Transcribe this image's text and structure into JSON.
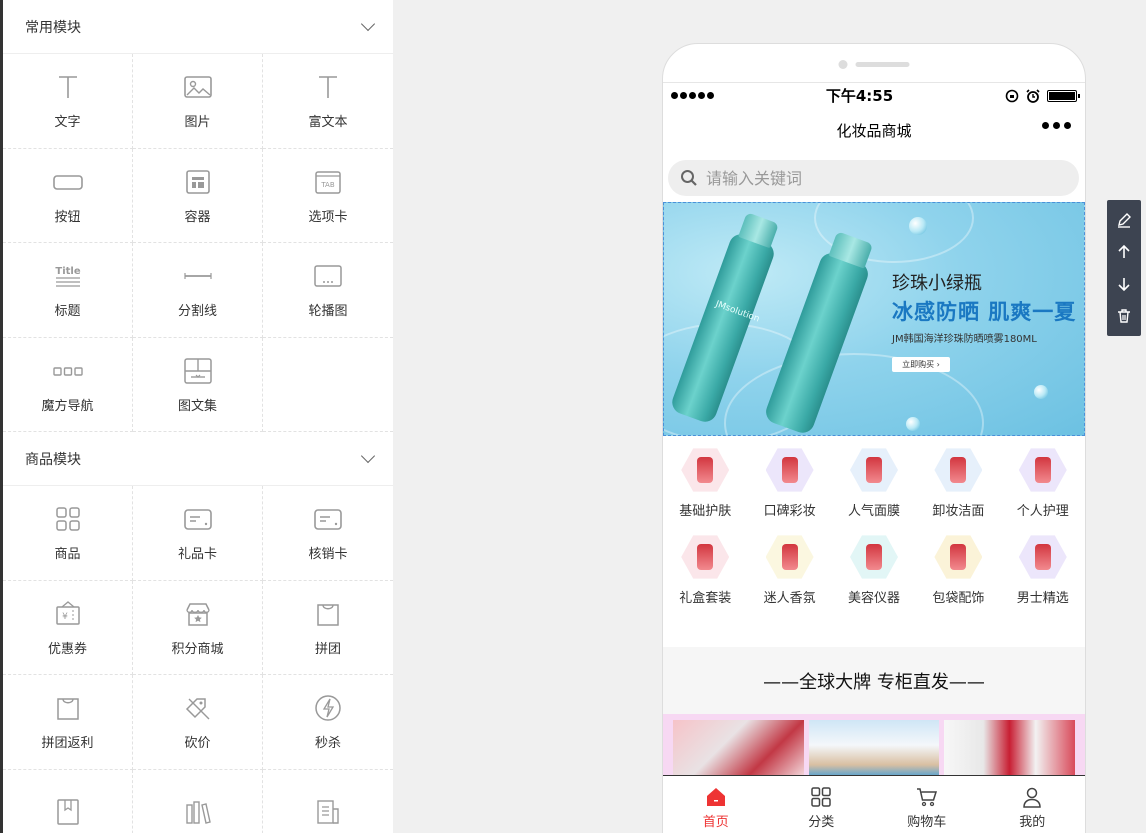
{
  "panel": {
    "sections": [
      {
        "title": "常用模块",
        "items": [
          {
            "label": "文字",
            "icon": "text-icon"
          },
          {
            "label": "图片",
            "icon": "image-icon"
          },
          {
            "label": "富文本",
            "icon": "rich-text-icon"
          },
          {
            "label": "按钮",
            "icon": "button-icon"
          },
          {
            "label": "容器",
            "icon": "container-icon"
          },
          {
            "label": "选项卡",
            "icon": "tab-icon"
          },
          {
            "label": "标题",
            "icon": "title-icon"
          },
          {
            "label": "分割线",
            "icon": "divider-icon"
          },
          {
            "label": "轮播图",
            "icon": "carousel-icon"
          },
          {
            "label": "魔方导航",
            "icon": "cube-nav-icon"
          },
          {
            "label": "图文集",
            "icon": "gallery-icon"
          }
        ]
      },
      {
        "title": "商品模块",
        "items": [
          {
            "label": "商品",
            "icon": "goods-icon"
          },
          {
            "label": "礼品卡",
            "icon": "gift-card-icon"
          },
          {
            "label": "核销卡",
            "icon": "verify-card-icon"
          },
          {
            "label": "优惠券",
            "icon": "coupon-icon"
          },
          {
            "label": "积分商城",
            "icon": "points-mall-icon"
          },
          {
            "label": "拼团",
            "icon": "group-buy-icon"
          },
          {
            "label": "拼团返利",
            "icon": "group-rebate-icon"
          },
          {
            "label": "砍价",
            "icon": "bargain-icon"
          },
          {
            "label": "秒杀",
            "icon": "flash-sale-icon"
          }
        ]
      }
    ]
  },
  "phone": {
    "status": {
      "time": "下午4:55"
    },
    "title": "化妆品商城",
    "search_placeholder": "请输入关键词",
    "banner": {
      "line1": "珍珠小绿瓶",
      "line2": "冰感防晒 肌爽一夏",
      "line3": "JM韩国海洋珍珠防晒喷雾180ML",
      "button": "立即购买 ›",
      "bottle_tag": "JMsolution"
    },
    "categories": [
      {
        "name": "基础护肤",
        "color": "#fbe6ea"
      },
      {
        "name": "口碑彩妆",
        "color": "#ece6fb"
      },
      {
        "name": "人气面膜",
        "color": "#e6f0fb"
      },
      {
        "name": "卸妆洁面",
        "color": "#e6f0fb"
      },
      {
        "name": "个人护理",
        "color": "#ece6fb"
      },
      {
        "name": "礼盒套装",
        "color": "#fbe6ea"
      },
      {
        "name": "迷人香氛",
        "color": "#fbf7e0"
      },
      {
        "name": "美容仪器",
        "color": "#e2f6f6"
      },
      {
        "name": "包袋配饰",
        "color": "#fbf3d8"
      },
      {
        "name": "男士精选",
        "color": "#ece6fb"
      }
    ],
    "section_title": "——全球大牌 专柜直发——",
    "tabs": [
      {
        "label": "首页",
        "icon": "home-icon",
        "active": true
      },
      {
        "label": "分类",
        "icon": "category-icon",
        "active": false
      },
      {
        "label": "购物车",
        "icon": "cart-icon",
        "active": false
      },
      {
        "label": "我的",
        "icon": "user-icon",
        "active": false
      }
    ]
  },
  "colors": {
    "accent": "#e33333",
    "banner_blue": "#1a78c2",
    "toolbar": "#3d4451"
  }
}
